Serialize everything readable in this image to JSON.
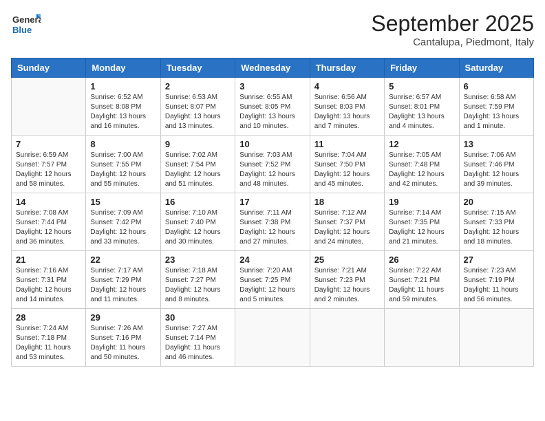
{
  "logo": {
    "line1": "General",
    "line2": "Blue"
  },
  "title": "September 2025",
  "location": "Cantalupa, Piedmont, Italy",
  "days_of_week": [
    "Sunday",
    "Monday",
    "Tuesday",
    "Wednesday",
    "Thursday",
    "Friday",
    "Saturday"
  ],
  "weeks": [
    [
      {
        "day": "",
        "sunrise": "",
        "sunset": "",
        "daylight": ""
      },
      {
        "day": "1",
        "sunrise": "Sunrise: 6:52 AM",
        "sunset": "Sunset: 8:08 PM",
        "daylight": "Daylight: 13 hours and 16 minutes."
      },
      {
        "day": "2",
        "sunrise": "Sunrise: 6:53 AM",
        "sunset": "Sunset: 8:07 PM",
        "daylight": "Daylight: 13 hours and 13 minutes."
      },
      {
        "day": "3",
        "sunrise": "Sunrise: 6:55 AM",
        "sunset": "Sunset: 8:05 PM",
        "daylight": "Daylight: 13 hours and 10 minutes."
      },
      {
        "day": "4",
        "sunrise": "Sunrise: 6:56 AM",
        "sunset": "Sunset: 8:03 PM",
        "daylight": "Daylight: 13 hours and 7 minutes."
      },
      {
        "day": "5",
        "sunrise": "Sunrise: 6:57 AM",
        "sunset": "Sunset: 8:01 PM",
        "daylight": "Daylight: 13 hours and 4 minutes."
      },
      {
        "day": "6",
        "sunrise": "Sunrise: 6:58 AM",
        "sunset": "Sunset: 7:59 PM",
        "daylight": "Daylight: 13 hours and 1 minute."
      }
    ],
    [
      {
        "day": "7",
        "sunrise": "Sunrise: 6:59 AM",
        "sunset": "Sunset: 7:57 PM",
        "daylight": "Daylight: 12 hours and 58 minutes."
      },
      {
        "day": "8",
        "sunrise": "Sunrise: 7:00 AM",
        "sunset": "Sunset: 7:55 PM",
        "daylight": "Daylight: 12 hours and 55 minutes."
      },
      {
        "day": "9",
        "sunrise": "Sunrise: 7:02 AM",
        "sunset": "Sunset: 7:54 PM",
        "daylight": "Daylight: 12 hours and 51 minutes."
      },
      {
        "day": "10",
        "sunrise": "Sunrise: 7:03 AM",
        "sunset": "Sunset: 7:52 PM",
        "daylight": "Daylight: 12 hours and 48 minutes."
      },
      {
        "day": "11",
        "sunrise": "Sunrise: 7:04 AM",
        "sunset": "Sunset: 7:50 PM",
        "daylight": "Daylight: 12 hours and 45 minutes."
      },
      {
        "day": "12",
        "sunrise": "Sunrise: 7:05 AM",
        "sunset": "Sunset: 7:48 PM",
        "daylight": "Daylight: 12 hours and 42 minutes."
      },
      {
        "day": "13",
        "sunrise": "Sunrise: 7:06 AM",
        "sunset": "Sunset: 7:46 PM",
        "daylight": "Daylight: 12 hours and 39 minutes."
      }
    ],
    [
      {
        "day": "14",
        "sunrise": "Sunrise: 7:08 AM",
        "sunset": "Sunset: 7:44 PM",
        "daylight": "Daylight: 12 hours and 36 minutes."
      },
      {
        "day": "15",
        "sunrise": "Sunrise: 7:09 AM",
        "sunset": "Sunset: 7:42 PM",
        "daylight": "Daylight: 12 hours and 33 minutes."
      },
      {
        "day": "16",
        "sunrise": "Sunrise: 7:10 AM",
        "sunset": "Sunset: 7:40 PM",
        "daylight": "Daylight: 12 hours and 30 minutes."
      },
      {
        "day": "17",
        "sunrise": "Sunrise: 7:11 AM",
        "sunset": "Sunset: 7:38 PM",
        "daylight": "Daylight: 12 hours and 27 minutes."
      },
      {
        "day": "18",
        "sunrise": "Sunrise: 7:12 AM",
        "sunset": "Sunset: 7:37 PM",
        "daylight": "Daylight: 12 hours and 24 minutes."
      },
      {
        "day": "19",
        "sunrise": "Sunrise: 7:14 AM",
        "sunset": "Sunset: 7:35 PM",
        "daylight": "Daylight: 12 hours and 21 minutes."
      },
      {
        "day": "20",
        "sunrise": "Sunrise: 7:15 AM",
        "sunset": "Sunset: 7:33 PM",
        "daylight": "Daylight: 12 hours and 18 minutes."
      }
    ],
    [
      {
        "day": "21",
        "sunrise": "Sunrise: 7:16 AM",
        "sunset": "Sunset: 7:31 PM",
        "daylight": "Daylight: 12 hours and 14 minutes."
      },
      {
        "day": "22",
        "sunrise": "Sunrise: 7:17 AM",
        "sunset": "Sunset: 7:29 PM",
        "daylight": "Daylight: 12 hours and 11 minutes."
      },
      {
        "day": "23",
        "sunrise": "Sunrise: 7:18 AM",
        "sunset": "Sunset: 7:27 PM",
        "daylight": "Daylight: 12 hours and 8 minutes."
      },
      {
        "day": "24",
        "sunrise": "Sunrise: 7:20 AM",
        "sunset": "Sunset: 7:25 PM",
        "daylight": "Daylight: 12 hours and 5 minutes."
      },
      {
        "day": "25",
        "sunrise": "Sunrise: 7:21 AM",
        "sunset": "Sunset: 7:23 PM",
        "daylight": "Daylight: 12 hours and 2 minutes."
      },
      {
        "day": "26",
        "sunrise": "Sunrise: 7:22 AM",
        "sunset": "Sunset: 7:21 PM",
        "daylight": "Daylight: 11 hours and 59 minutes."
      },
      {
        "day": "27",
        "sunrise": "Sunrise: 7:23 AM",
        "sunset": "Sunset: 7:19 PM",
        "daylight": "Daylight: 11 hours and 56 minutes."
      }
    ],
    [
      {
        "day": "28",
        "sunrise": "Sunrise: 7:24 AM",
        "sunset": "Sunset: 7:18 PM",
        "daylight": "Daylight: 11 hours and 53 minutes."
      },
      {
        "day": "29",
        "sunrise": "Sunrise: 7:26 AM",
        "sunset": "Sunset: 7:16 PM",
        "daylight": "Daylight: 11 hours and 50 minutes."
      },
      {
        "day": "30",
        "sunrise": "Sunrise: 7:27 AM",
        "sunset": "Sunset: 7:14 PM",
        "daylight": "Daylight: 11 hours and 46 minutes."
      },
      {
        "day": "",
        "sunrise": "",
        "sunset": "",
        "daylight": ""
      },
      {
        "day": "",
        "sunrise": "",
        "sunset": "",
        "daylight": ""
      },
      {
        "day": "",
        "sunrise": "",
        "sunset": "",
        "daylight": ""
      },
      {
        "day": "",
        "sunrise": "",
        "sunset": "",
        "daylight": ""
      }
    ]
  ]
}
